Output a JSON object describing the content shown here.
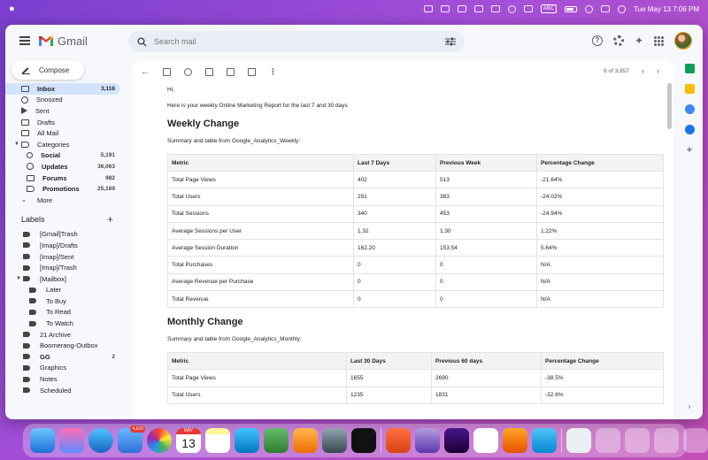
{
  "menubar": {
    "clock": "Tue May 13  7:06 PM",
    "input_source": "ABC"
  },
  "gmail": {
    "logo_text": "Gmail",
    "search": {
      "placeholder": "Search mail"
    },
    "compose_label": "Compose",
    "nav": [
      {
        "label": "Inbox",
        "count": "3,116",
        "active": true,
        "icon": "inbox-icon"
      },
      {
        "label": "Snoozed",
        "count": "",
        "icon": "clock-icon"
      },
      {
        "label": "Sent",
        "count": "",
        "icon": "send-icon"
      },
      {
        "label": "Drafts",
        "count": "",
        "icon": "draft-icon"
      },
      {
        "label": "All Mail",
        "count": "",
        "icon": "all-mail-icon"
      },
      {
        "label": "Categories",
        "count": "",
        "icon": "label-icon"
      }
    ],
    "categories": [
      {
        "label": "Social",
        "count": "5,191"
      },
      {
        "label": "Updates",
        "count": "36,063"
      },
      {
        "label": "Forums",
        "count": "982"
      },
      {
        "label": "Promotions",
        "count": "25,169"
      }
    ],
    "more_label": "More",
    "labels_heading": "Labels",
    "labels": [
      {
        "label": "[Gmail]Trash",
        "level": 1
      },
      {
        "label": "[Imap]/Drafts",
        "level": 1
      },
      {
        "label": "[Imap]/Sent",
        "level": 1
      },
      {
        "label": "[Imap]/Trash",
        "level": 1
      },
      {
        "label": "[Mailbox]",
        "level": 1
      },
      {
        "label": "Later",
        "level": 2
      },
      {
        "label": "To Buy",
        "level": 2
      },
      {
        "label": "To Read",
        "level": 2
      },
      {
        "label": "To Watch",
        "level": 2
      },
      {
        "label": "21 Archive",
        "level": 1
      },
      {
        "label": "Boomerang-Outbox",
        "level": 1
      },
      {
        "label": "GG",
        "level": 1,
        "count": "2"
      },
      {
        "label": "Graphics",
        "level": 1
      },
      {
        "label": "Notes",
        "level": 1
      },
      {
        "label": "Scheduled",
        "level": 1
      }
    ],
    "pager": "6 of 3,857"
  },
  "email": {
    "greeting": "Hi,",
    "intro": "Here is your weekly Online Marketing Report for the last 7 and 30 days",
    "weekly": {
      "heading": "Weekly Change",
      "caption": "Summary and table from Google_Analytics_Weekly:",
      "columns": [
        "Metric",
        "Last 7 Days",
        "Previous Week",
        "Percentage Change"
      ],
      "rows": [
        [
          "Total Page Views",
          "402",
          "513",
          "-21.64%"
        ],
        [
          "Total Users",
          "291",
          "383",
          "-24.02%"
        ],
        [
          "Total Sessions",
          "340",
          "453",
          "-24.94%"
        ],
        [
          "Average Sessions per User",
          "1.32",
          "1.30",
          "1.22%"
        ],
        [
          "Average Session Duration",
          "162.20",
          "153.54",
          "5.64%"
        ],
        [
          "Total Purchases",
          "0",
          "0",
          "N/A"
        ],
        [
          "Average Revenue per Purchase",
          "0",
          "0",
          "N/A"
        ],
        [
          "Total Revenue",
          "0",
          "0",
          "N/A"
        ]
      ]
    },
    "monthly": {
      "heading": "Monthly Change",
      "caption": "Summary and table from Google_Analytics_Monthly:",
      "columns": [
        "Metric",
        "Last 30 Days",
        "Previous 60 days",
        "Percentage Change"
      ],
      "rows": [
        [
          "Total Page Views",
          "1655",
          "2690",
          "-38.5%"
        ],
        [
          "Total Users",
          "1235",
          "1831",
          "-32.6%"
        ]
      ]
    }
  },
  "dock": {
    "mail_badge": "4,920",
    "calendar_month": "MAY",
    "calendar_day": "13"
  },
  "colors": {
    "desktop": "#8a43d4",
    "active_nav": "#d3e3fd",
    "gmail_red": "#ea4335",
    "gmail_blue": "#4285f4",
    "gmail_green": "#34a853",
    "gmail_yellow": "#fbbc04"
  }
}
